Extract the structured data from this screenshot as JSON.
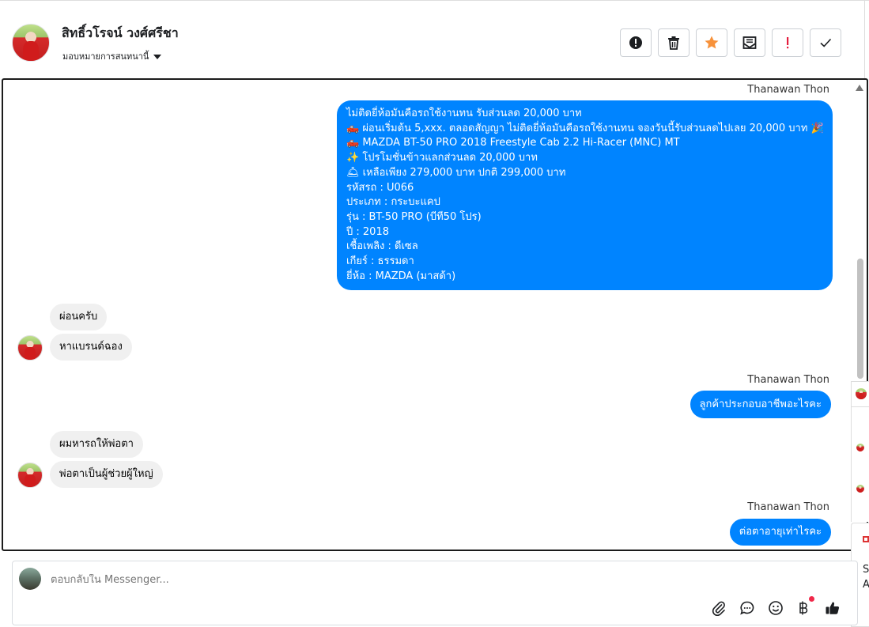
{
  "header": {
    "name": "สิทธิ์วโรจน์ วงศ์ศรีชา",
    "assign_label": "มอบหมายการสนทนานี้",
    "actions": [
      {
        "name": "spam-button",
        "icon": "alert-circle-icon"
      },
      {
        "name": "delete-button",
        "icon": "trash-icon"
      },
      {
        "name": "star-button",
        "icon": "star-icon"
      },
      {
        "name": "mark-unread-button",
        "icon": "envelope-icon"
      },
      {
        "name": "follow-up-button",
        "icon": "exclamation-icon"
      },
      {
        "name": "done-button",
        "icon": "check-icon"
      }
    ]
  },
  "conversation": {
    "sender_name": "Thanawan Thon",
    "long_message_lines": [
      "ไม่ติดยี่ห้อมันคือรถใช้งานทน รับส่วนลด 20,000 บาท",
      "🛻 ผ่อนเริ่มต้น 5,xxx. ตลอดสัญญา ไม่ติดยี่ห้อมันคือรถใช้งานทน จองวันนี้รับส่วนลดไปเลย 20,000 บาท 🎉",
      "🛻 MAZDA BT-50 PRO 2018 Freestyle Cab 2.2 Hi-Racer (MNC) MT",
      "✨ โปรโมชั่นข้าวแลกส่วนลด 20,000 บาท",
      "🛎 เหลือเพียง 279,000 บาท ปกติ 299,000 บาท",
      "รหัสรถ : U066",
      "ประเภท : กระบะแคป",
      "รุ่น : BT-50 PRO (บีที50 โปร)",
      "ปี : 2018",
      "เชื้อเพลิง : ดีเซล",
      "เกียร์ : ธรรมดา",
      "ยี่ห้อ : MAZDA (มาสด้า)"
    ],
    "incoming_1": [
      "ผ่อนครับ",
      "หาแบรนด์ฉอง"
    ],
    "outgoing_1": "ลูกค้าประกอบอาชีพอะไรคะ",
    "incoming_2": [
      "ผมหารถให้พ่อตา",
      "พ่อตาเป็นผู้ช่วยผู้ใหญ่"
    ],
    "outgoing_2": "ต่อตาอายุเท่าไรคะ"
  },
  "reply": {
    "placeholder": "ตอบกลับใน Messenger...",
    "tools": [
      "paperclip-icon",
      "chat-bubble-icon",
      "emoji-icon",
      "baht-icon",
      "thumbs-up-icon"
    ]
  },
  "edge": {
    "letter_1": "S",
    "letter_2": "A"
  },
  "colors": {
    "outgoing_bubble": "#0084ff",
    "incoming_bubble": "#f0f0f0",
    "star": "#f7923b",
    "follow_up": "#e41e3f"
  }
}
